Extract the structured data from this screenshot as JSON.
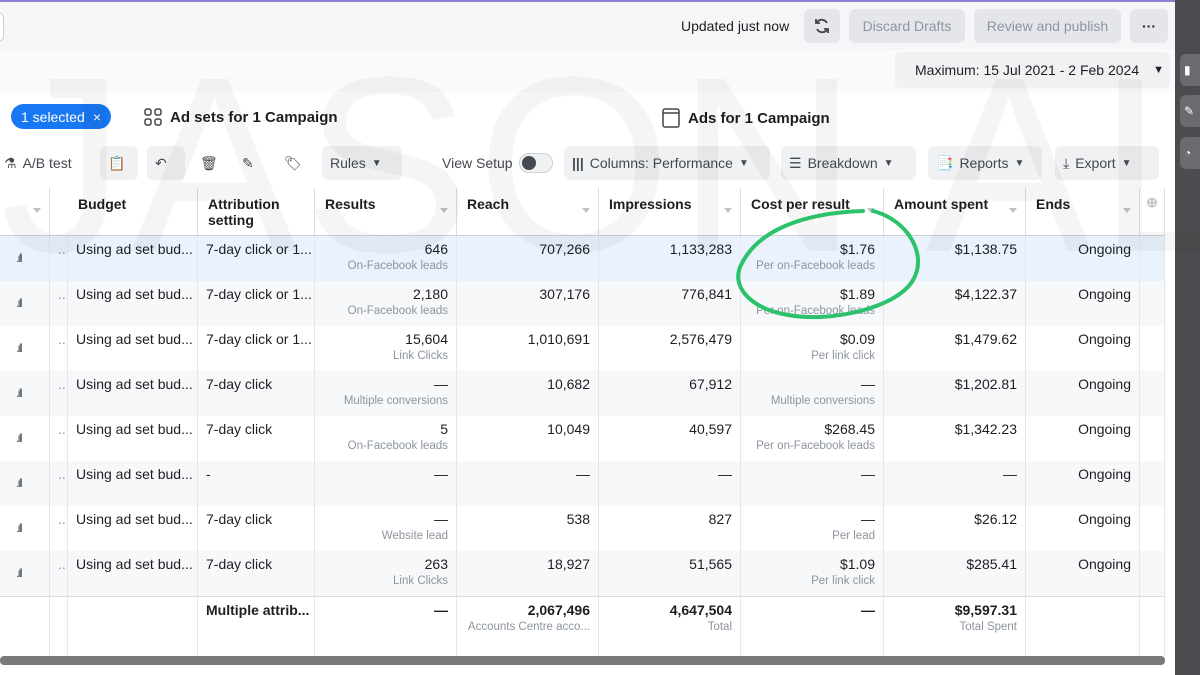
{
  "header": {
    "updated": "Updated just now",
    "discard": "Discard Drafts",
    "review": "Review and publish",
    "more": "···"
  },
  "date_range": "Maximum: 15 Jul 2021 - 2 Feb 2024",
  "selection": {
    "label": "1 selected",
    "clear": "×"
  },
  "tabs": [
    {
      "label": "Ad sets for 1 Campaign"
    },
    {
      "label": "Ads for 1 Campaign"
    }
  ],
  "toolbar": {
    "ab_test": "A/B test",
    "rules": "Rules",
    "view_setup": "View Setup",
    "columns": "Columns: Performance",
    "breakdown": "Breakdown",
    "reports": "Reports",
    "export": "Export"
  },
  "columns": [
    "Budget",
    "Attribution setting",
    "Results",
    "Reach",
    "Impressions",
    "Cost per result",
    "Amount spent",
    "Ends"
  ],
  "rows": [
    {
      "budget": "Using ad set bud...",
      "attr": "7-day click or 1...",
      "results": "646",
      "results_sub": "On-Facebook leads",
      "reach": "707,266",
      "impr": "1,133,283",
      "cpr": "$1.76",
      "cpr_sub": "Per on-Facebook leads",
      "spent": "$1,138.75",
      "ends": "Ongoing"
    },
    {
      "budget": "Using ad set bud...",
      "attr": "7-day click or 1...",
      "results": "2,180",
      "results_sub": "On-Facebook leads",
      "reach": "307,176",
      "impr": "776,841",
      "cpr": "$1.89",
      "cpr_sub": "Per on-Facebook leads",
      "spent": "$4,122.37",
      "ends": "Ongoing"
    },
    {
      "budget": "Using ad set bud...",
      "attr": "7-day click or 1...",
      "results": "15,604",
      "results_sub": "Link Clicks",
      "reach": "1,010,691",
      "impr": "2,576,479",
      "cpr": "$0.09",
      "cpr_sub": "Per link click",
      "spent": "$1,479.62",
      "ends": "Ongoing"
    },
    {
      "budget": "Using ad set bud...",
      "attr": "7-day click",
      "results": "—",
      "results_sub": "Multiple conversions",
      "reach": "10,682",
      "impr": "67,912",
      "cpr": "—",
      "cpr_sub": "Multiple conversions",
      "spent": "$1,202.81",
      "ends": "Ongoing"
    },
    {
      "budget": "Using ad set bud...",
      "attr": "7-day click",
      "results": "5",
      "results_sub": "On-Facebook leads",
      "reach": "10,049",
      "impr": "40,597",
      "cpr": "$268.45",
      "cpr_sub": "Per on-Facebook leads",
      "spent": "$1,342.23",
      "ends": "Ongoing"
    },
    {
      "budget": "Using ad set bud...",
      "attr": "-",
      "results": "—",
      "results_sub": "",
      "reach": "—",
      "impr": "—",
      "cpr": "—",
      "cpr_sub": "",
      "spent": "—",
      "ends": "Ongoing"
    },
    {
      "budget": "Using ad set bud...",
      "attr": "7-day click",
      "results": "—",
      "results_sub": "Website lead",
      "reach": "538",
      "impr": "827",
      "cpr": "—",
      "cpr_sub": "Per lead",
      "spent": "$26.12",
      "ends": "Ongoing"
    },
    {
      "budget": "Using ad set bud...",
      "attr": "7-day click",
      "results": "263",
      "results_sub": "Link Clicks",
      "reach": "18,927",
      "impr": "51,565",
      "cpr": "$1.09",
      "cpr_sub": "Per link click",
      "spent": "$285.41",
      "ends": "Ongoing"
    }
  ],
  "totals": {
    "attr": "Multiple attrib...",
    "results": "—",
    "reach": "2,067,496",
    "reach_sub": "Accounts Centre acco...",
    "impr": "4,647,504",
    "impr_sub": "Total",
    "cpr": "—",
    "spent": "$9,597.31",
    "spent_sub": "Total Spent"
  },
  "watermark": "JASON ALMINE",
  "colors": {
    "accent": "#1877f2",
    "highlight": "#2bc26b",
    "selected_row": "#eaf2fd"
  }
}
